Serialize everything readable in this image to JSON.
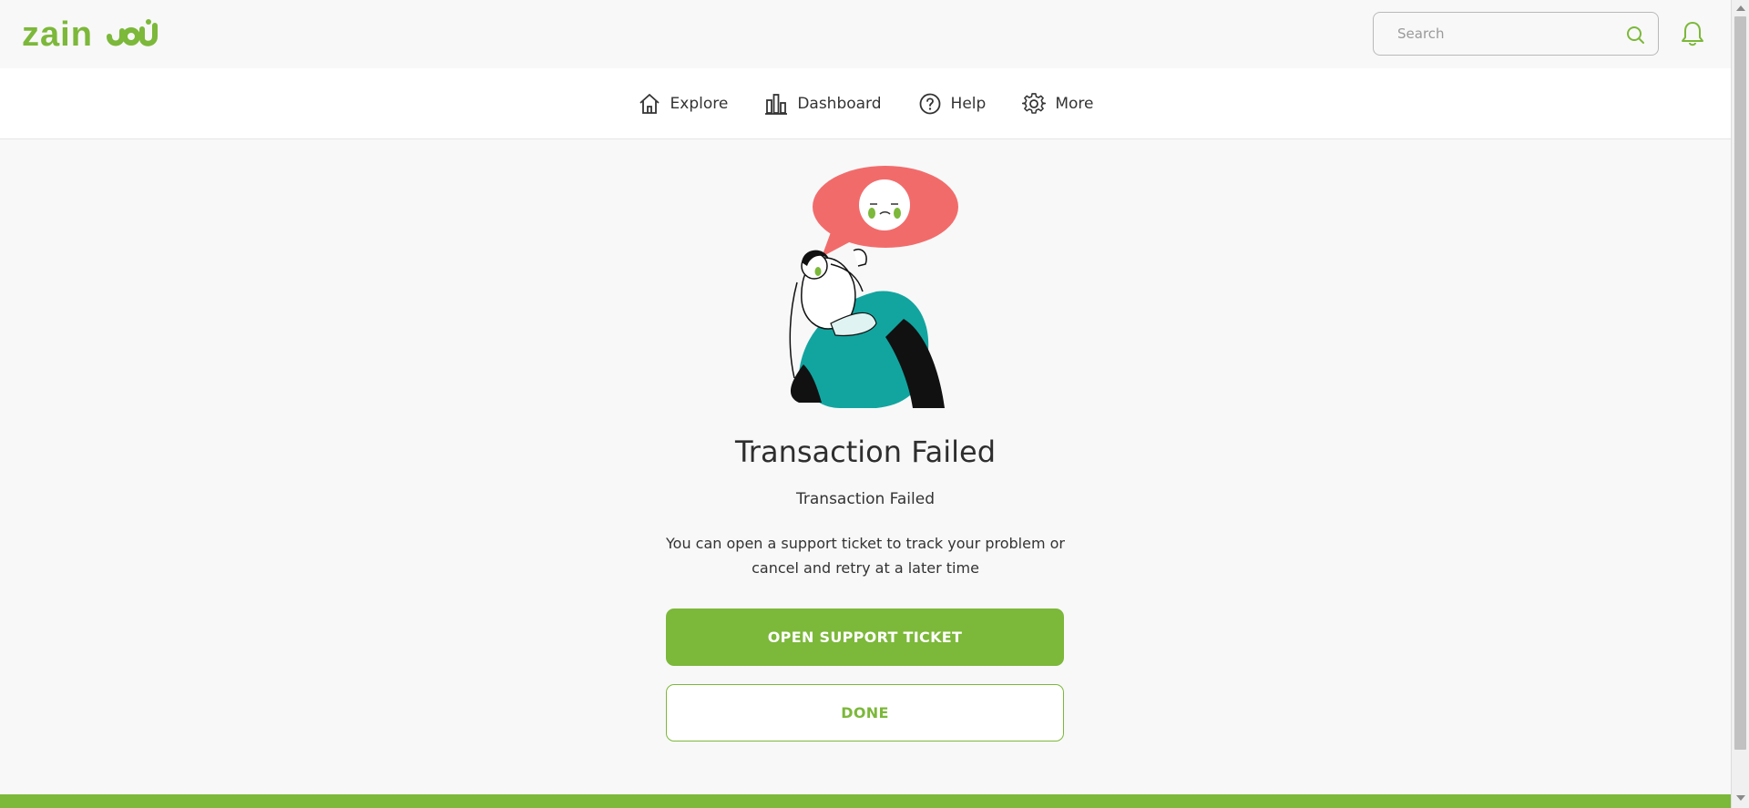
{
  "brand": {
    "logo_text": "zain",
    "accent_color": "#7cb83a"
  },
  "header": {
    "search": {
      "placeholder": "Search",
      "value": "",
      "icon": "search-icon"
    },
    "notifications_icon": "bell-icon"
  },
  "nav": {
    "items": [
      {
        "label": "Explore",
        "icon": "home-icon"
      },
      {
        "label": "Dashboard",
        "icon": "bar-chart-icon"
      },
      {
        "label": "Help",
        "icon": "question-circle-icon"
      },
      {
        "label": "More",
        "icon": "gear-icon"
      }
    ]
  },
  "status": {
    "title": "Transaction Failed",
    "subtitle": "Transaction Failed",
    "description": "You can open a support ticket to track your problem or cancel and retry at a later time",
    "illustration": "sad-person-illustration"
  },
  "actions": {
    "primary_label": "OPEN SUPPORT TICKET",
    "secondary_label": "DONE"
  }
}
